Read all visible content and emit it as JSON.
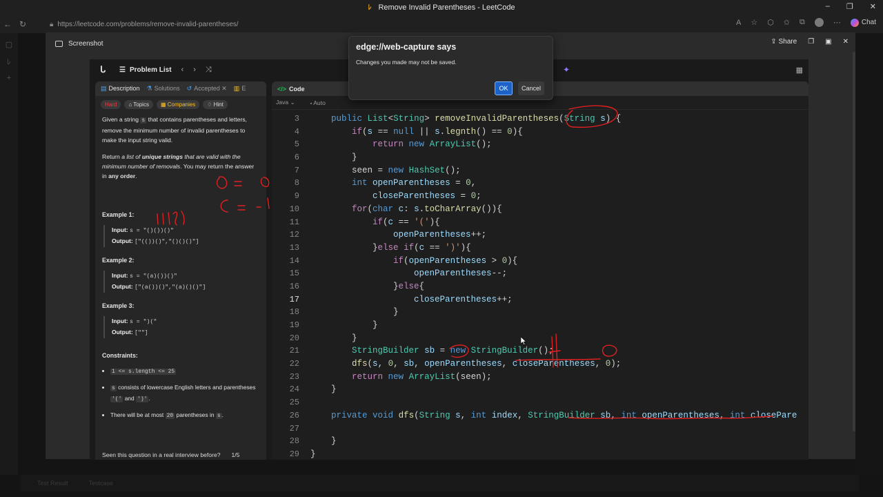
{
  "window": {
    "title": "Remove Invalid Parentheses - LeetCode",
    "controls": [
      "–",
      "❐",
      "✕"
    ]
  },
  "browser": {
    "url": "https://leetcode.com/problems/remove-invalid-parentheses/",
    "chat_label": "Chat"
  },
  "overlay": {
    "title": "Screenshot",
    "share_label": "Share"
  },
  "dialog": {
    "title": "edge://web-capture says",
    "message": "Changes you made may not be saved.",
    "ok_label": "OK",
    "cancel_label": "Cancel"
  },
  "leetcode": {
    "problem_list_label": "Problem List",
    "tabs": {
      "description": "Description",
      "solutions": "Solutions",
      "accepted": "Accepted",
      "editorial_short": "E"
    },
    "badges": {
      "difficulty": "Hard",
      "topics": "Topics",
      "companies": "Companies",
      "hint": "Hint"
    },
    "description": {
      "p1_a": "Given a string ",
      "p1_code": "s",
      "p1_b": " that contains parentheses and letters, remove the minimum number of invalid parentheses to make the input string valid.",
      "p2_a": "Return ",
      "p2_b": "a list of ",
      "p2_c": "unique strings",
      "p2_d": " that are valid with the minimum number of removals",
      "p2_e": ". You may return the answer in ",
      "p2_f": "any order",
      "p2_g": "."
    },
    "examples": [
      {
        "title": "Example 1:",
        "input_label": "Input:",
        "input": "s = \"()())()\"",
        "output_label": "Output:",
        "output": "[\"(())()\",\"()()()\"]"
      },
      {
        "title": "Example 2:",
        "input_label": "Input:",
        "input": "s = \"(a)())()\"",
        "output_label": "Output:",
        "output": "[\"(a())()\",\"(a)()()\"]"
      },
      {
        "title": "Example 3:",
        "input_label": "Input:",
        "input": "s = \")(\"",
        "output_label": "Output:",
        "output": "[\"\"]"
      }
    ],
    "constraints_title": "Constraints:",
    "constraints": {
      "c1": "1 <= s.length <= 25",
      "c2_code": "s",
      "c2_text": " consists of lowercase English letters and parentheses ",
      "c2_p1": "'('",
      "c2_and": " and ",
      "c2_p2": "')'",
      "c2_end": ".",
      "c3_a": "There will be at most ",
      "c3_code": "20",
      "c3_b": " parentheses in ",
      "c3_code2": "s",
      "c3_end": "."
    },
    "footer": {
      "question": "Seen this question in a real interview before?",
      "counter": "1/5"
    },
    "code_panel": {
      "title": "Code",
      "language": "Java",
      "mode": "Auto"
    },
    "code_line_numbers": [
      "3",
      "4",
      "5",
      "6",
      "7",
      "8",
      "9",
      "10",
      "11",
      "12",
      "13",
      "14",
      "15",
      "16",
      "17",
      "18",
      "19",
      "20",
      "21",
      "22",
      "23",
      "24",
      "25",
      "26",
      "27",
      "28",
      "29"
    ]
  },
  "background": {
    "bottom_tabs": [
      "Test Result",
      "Testcase"
    ]
  }
}
